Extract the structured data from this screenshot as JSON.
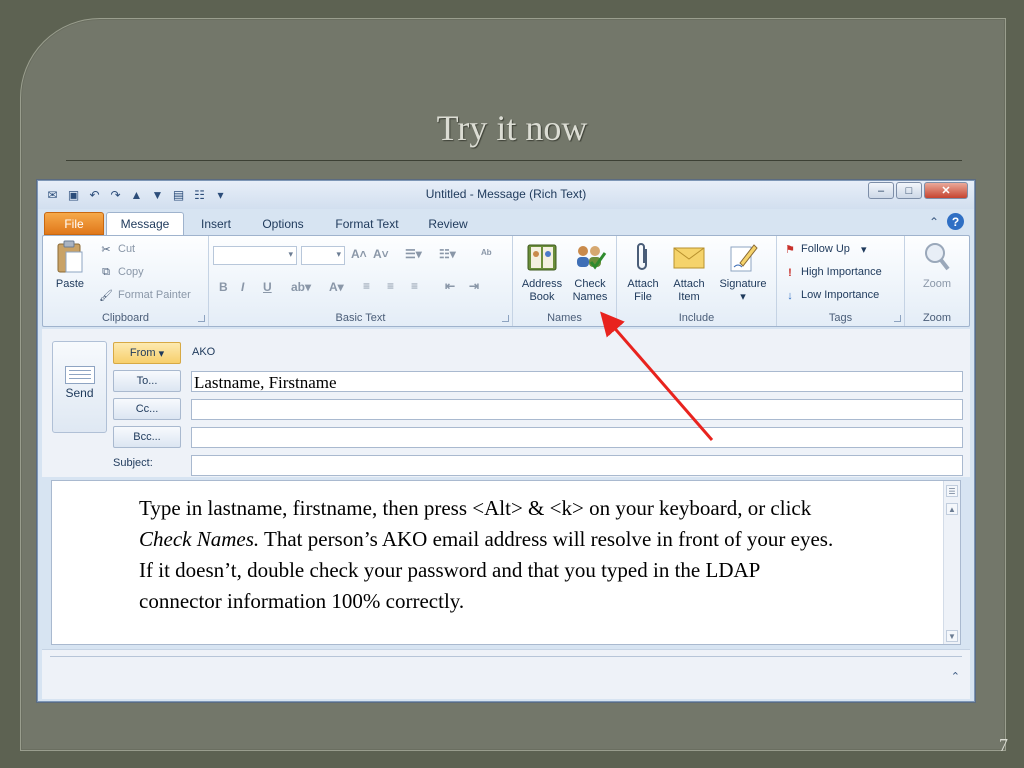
{
  "slide": {
    "title": "Try it now",
    "page_number": "7"
  },
  "window": {
    "title": "Untitled  -  Message (Rich Text)",
    "controls": {
      "minimize": "–",
      "maximize": "□",
      "close": "✕"
    }
  },
  "quick_access": [
    "save-icon",
    "undo-icon",
    "redo-icon",
    "up-icon",
    "down-icon",
    "folder-icon",
    "address-icon",
    "dropdown-icon"
  ],
  "tabs": [
    {
      "label": "File"
    },
    {
      "label": "Message"
    },
    {
      "label": "Insert"
    },
    {
      "label": "Options"
    },
    {
      "label": "Format Text"
    },
    {
      "label": "Review"
    }
  ],
  "ribbon": {
    "clipboard": {
      "paste": "Paste",
      "cut": "Cut",
      "copy": "Copy",
      "format_painter": "Format Painter",
      "label": "Clipboard"
    },
    "basic_text": {
      "bold": "B",
      "italic": "I",
      "underline": "U",
      "label": "Basic Text"
    },
    "names": {
      "address_book_1": "Address",
      "address_book_2": "Book",
      "check_names_1": "Check",
      "check_names_2": "Names",
      "label": "Names"
    },
    "include": {
      "attach_file_1": "Attach",
      "attach_file_2": "File",
      "attach_item_1": "Attach",
      "attach_item_2": "Item",
      "signature": "Signature",
      "label": "Include"
    },
    "tags": {
      "follow_up": "Follow Up",
      "high_importance": "High Importance",
      "low_importance": "Low Importance",
      "label": "Tags"
    },
    "zoom": {
      "zoom": "Zoom",
      "label": "Zoom"
    }
  },
  "compose": {
    "send": "Send",
    "from_button": "From",
    "from_value": "AKO",
    "to_button": "To...",
    "cc_button": "Cc...",
    "bcc_button": "Bcc...",
    "subject_label": "Subject:",
    "to_value": "Lastname, Firstname",
    "cc_value": "",
    "bcc_value": "",
    "subject_value": ""
  },
  "body": {
    "text_part1": "Type in lastname, firstname, then press <Alt> & <k> on your keyboard, or click ",
    "text_italic": "Check Names.",
    "text_part2": "  That person’s AKO email address will resolve in front of your eyes.  If it doesn’t, double check your password and that you typed in the LDAP connector information 100% correctly."
  },
  "colors": {
    "annotation_arrow": "#e8231e",
    "file_tab": "#e0781a",
    "from_button": "#f7cf6c"
  }
}
